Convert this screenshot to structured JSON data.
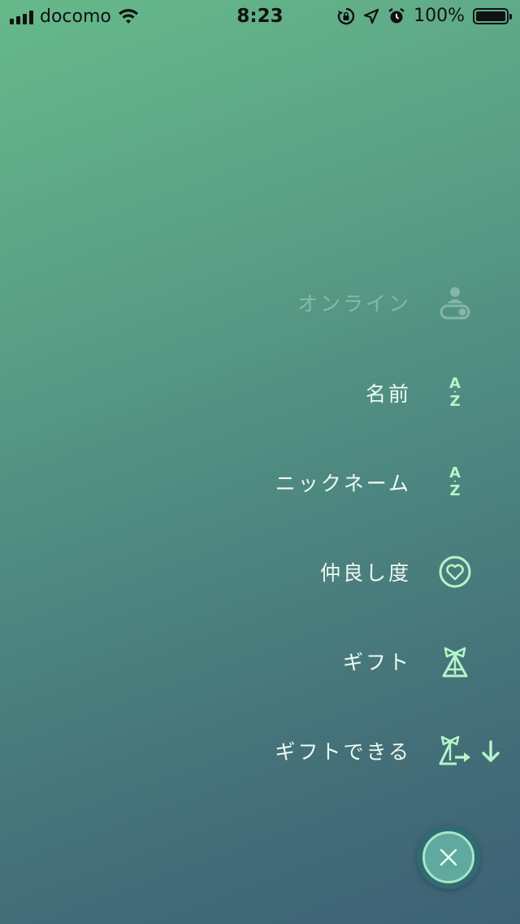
{
  "status_bar": {
    "carrier": "docomo",
    "time": "8:23",
    "battery": "100%"
  },
  "sort_menu": {
    "options": [
      {
        "label": "オンライン",
        "icon": "online-toggle-icon",
        "enabled": false
      },
      {
        "label": "名前",
        "icon": "az-sort-icon",
        "enabled": true
      },
      {
        "label": "ニックネーム",
        "icon": "az-sort-icon",
        "enabled": true
      },
      {
        "label": "仲良し度",
        "icon": "heart-icon",
        "enabled": true
      },
      {
        "label": "ギフト",
        "icon": "gift-icon",
        "enabled": true
      },
      {
        "label": "ギフトできる",
        "icon": "send-gift-icon",
        "enabled": true,
        "selected": true
      }
    ],
    "az_top": "A",
    "az_bottom": "Z",
    "sort_direction": "descending",
    "close_icon": "close-icon"
  },
  "colors": {
    "accent": "#b6f5c8",
    "label": "#eefbf1",
    "close_button_fill": "#5fa99e"
  }
}
